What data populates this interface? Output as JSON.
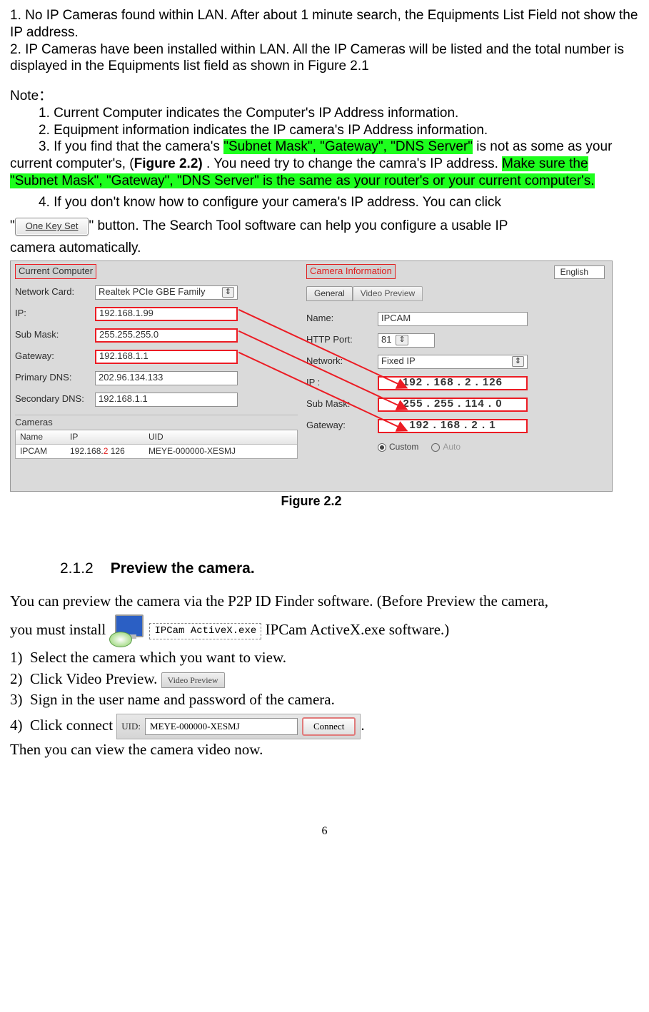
{
  "intro": {
    "p1": "1. No IP Cameras found within LAN. After about 1 minute search, the Equipments List Field not show the IP address.",
    "p2": "2. IP Cameras have been installed within LAN. All the IP Cameras will be listed and the total number is displayed in the Equipments list field as shown in Figure 2.1"
  },
  "note_label": "Note：",
  "notes": {
    "n1": "1. Current Computer indicates the Computer's IP Address information.",
    "n2": "2.  Equipment information indicates the IP camera's IP Address information.",
    "n3_pre": "3.  If you find that the camera's  ",
    "n3_hl1": "\"Subnet Mask\", \"Gateway\", \"DNS Server\"",
    "n3_mid": " is not as some as your current computer's, (",
    "n3_figref": "Figure 2.2)",
    "n3_post": " . You need try to change the camra's IP address. ",
    "n3_hl2": "Make sure the \"Subnet Mask\", \"Gateway\", \"DNS Server\" is the same as your router's or your current computer's.",
    "n4_pre": "4.  If you don't know how to configure your camera's IP address. You can click",
    "n4_btn": "One Key Set",
    "n4_post_a": "\" button. The Search Tool software can help you configure a usable IP",
    "n4_post_b": "camera automatically."
  },
  "figure22": {
    "caption": "Figure 2.2",
    "lang": "English",
    "left": {
      "section": "Current Computer",
      "network_card_lbl": "Network Card:",
      "network_card_val": "Realtek PCIe GBE Family",
      "ip_lbl": "IP:",
      "ip_val": "192.168.1.99",
      "submask_lbl": "Sub Mask:",
      "submask_val": "255.255.255.0",
      "gateway_lbl": "Gateway:",
      "gateway_val": "192.168.1.1",
      "pdns_lbl": "Primary DNS:",
      "pdns_val": "202.96.134.133",
      "sdns_lbl": "Secondary DNS:",
      "sdns_val": "192.168.1.1",
      "cameras_lbl": "Cameras",
      "tbl_h1": "Name",
      "tbl_h2": "IP",
      "tbl_h3": "UID",
      "row_name": "IPCAM",
      "row_ip_a": "192.168.",
      "row_ip_b": "2",
      "row_ip_c": " 126",
      "row_uid": "MEYE-000000-XESMJ"
    },
    "right": {
      "section": "Camera Information",
      "tab1": "General",
      "tab2": "Video Preview",
      "name_lbl": "Name:",
      "name_val": "IPCAM",
      "port_lbl": "HTTP Port:",
      "port_val": "81",
      "net_lbl": "Network:",
      "net_val": "Fixed IP",
      "ip_lbl": "IP  :",
      "ip_val": "192 . 168 .   2    . 126",
      "submask_lbl": "Sub Mask:",
      "submask_val": "255 . 255 . 114 .  0",
      "gateway_lbl": "Gateway:",
      "gateway_val": "192 . 168 .   2   .   1",
      "radio1": "Custom",
      "radio2": "Auto"
    }
  },
  "sec212": {
    "num": "2.1.2",
    "title": "Preview the camera.",
    "p1_a": "You can preview the camera via the P2P ID Finder software. (Before Preview the camera,",
    "p1_b": "you must install ",
    "activex_label": "IPCam ActiveX.exe",
    "p1_c": " IPCam ActiveX.exe software.)",
    "li1": "Select the camera which you want to view.",
    "li2_a": "Click Video Preview. ",
    "li2_tab": "Video Preview",
    "li3": "Sign in the user name and password of the camera.",
    "li4_a": "Click connect ",
    "uid_lbl": "UID:",
    "uid_val": "MEYE-000000-XESMJ",
    "connect_btn": "Connect",
    "li4_b": ".",
    "p_last": "Then you can view the camera video now."
  },
  "page_number": "6"
}
